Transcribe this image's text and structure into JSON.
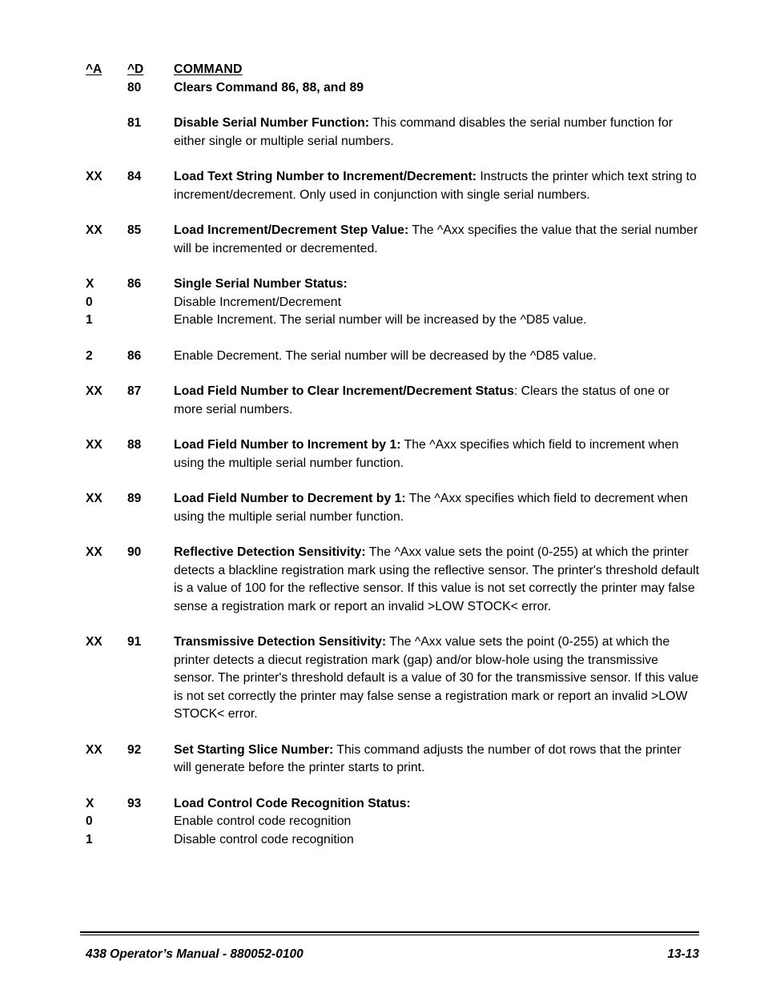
{
  "document": {
    "header": {
      "col_a": "^A",
      "col_d": "^D",
      "col_command": "COMMAND"
    },
    "entries": [
      {
        "code_a": "",
        "code_d": "80",
        "title": "Clears Command 86, 88, and 89",
        "title_bold_all": true,
        "body": ""
      },
      {
        "code_a": "",
        "code_d": "81",
        "title": "Disable Serial Number Function:",
        "body": " This command disables the serial number function for either single or multiple serial numbers."
      },
      {
        "code_a": "XX",
        "code_d": "84",
        "title": "Load Text String Number to Increment/Decrement:",
        "body": " Instructs the printer which text string to increment/decrement.  Only used in conjunction with single serial numbers."
      },
      {
        "code_a": "XX",
        "code_d": "85",
        "title": "Load Increment/Decrement Step Value:",
        "body": " The ^Axx specifies the value that the serial number will be incremented or decremented."
      },
      {
        "code_a": "X",
        "code_d": "86",
        "title": "Single Serial Number Status:",
        "body": "",
        "sublines": [
          {
            "code_a": "0",
            "text": "Disable Increment/Decrement"
          },
          {
            "code_a": "1",
            "text": "Enable Increment.  The serial number will be increased by the ^D85 value."
          }
        ]
      },
      {
        "code_a": "2",
        "code_d": "86",
        "title": "",
        "body": "Enable Decrement.  The serial number will be decreased by the ^D85 value."
      },
      {
        "code_a": "XX",
        "code_d": "87",
        "title": "Load Field Number to Clear Increment/Decrement Status",
        "title_colon_plain": true,
        "body": ": Clears the status of one or more serial numbers."
      },
      {
        "code_a": "XX",
        "code_d": "88",
        "title": "Load Field Number to Increment by 1:",
        "body": " The ^Axx specifies which field to increment when using the multiple serial number function."
      },
      {
        "code_a": "XX",
        "code_d": "89",
        "title": "Load Field Number to Decrement by 1:",
        "body": " The ^Axx specifies which field to decrement when using the multiple serial number function."
      },
      {
        "code_a": "XX",
        "code_d": "90",
        "title": "Reflective Detection Sensitivity:",
        "body": " The ^Axx value sets the point (0-255) at which the printer detects a blackline registration mark using the reflective sensor.  The printer's threshold default is a value of 100 for the reflective sensor.  If this value is not set correctly the printer may false sense a registration mark or report an invalid >LOW STOCK< error."
      },
      {
        "code_a": "XX",
        "code_d": "91",
        "title": "Transmissive Detection Sensitivity:",
        "body": " The ^Axx value sets the point (0-255) at which the printer detects a diecut registration mark (gap) and/or  blow-hole using the transmissive sensor.  The printer's threshold default is a value of 30 for the transmissive sensor.  If this value is not set correctly the printer may false sense a registration mark or report an invalid >LOW STOCK< error."
      },
      {
        "code_a": "XX",
        "code_d": "92",
        "title": "Set Starting Slice Number:",
        "body": " This command adjusts the number of dot rows that the printer will generate before the printer starts to print."
      },
      {
        "code_a": "X",
        "code_d": "93",
        "title": "Load Control Code Recognition Status:",
        "body": "",
        "sublines": [
          {
            "code_a": "0",
            "text": "Enable control code recognition"
          },
          {
            "code_a": "1",
            "text": "Disable control code recognition"
          }
        ]
      }
    ],
    "footer": {
      "manual": "438 Operator’s Manual - 880052-0100",
      "page_number": "13-13"
    }
  }
}
